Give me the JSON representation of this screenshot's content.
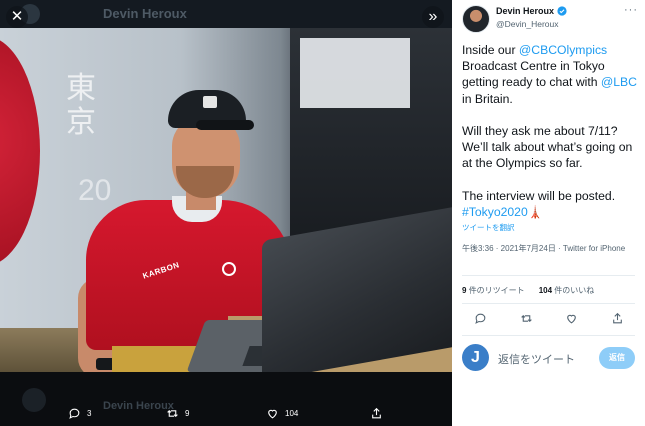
{
  "viewer": {
    "background_author": "Devin Heroux",
    "background_footer_author": "Devin Heroux",
    "background_bottom_avatar_letter": "J",
    "kanji_text": "東京",
    "year_text": "20",
    "shirt_brand": "KARBON",
    "close_icon": "close-icon",
    "collapse_icon": "chevrons-right-icon",
    "actions": {
      "reply_count": "3",
      "retweet_count": "9",
      "like_count": "104"
    }
  },
  "tweet": {
    "author_name": "Devin Heroux",
    "author_handle": "@Devin_Heroux",
    "more_label": "···",
    "text": {
      "p1_a": "Inside our ",
      "p1_link1": "@CBCOlympics",
      "p1_b": " Broadcast Centre in Tokyo getting ready to chat with ",
      "p1_link2": "@LBC",
      "p1_c": " in Britain.",
      "p2": "Will they ask me about 7/11? We’ll talk about what’s going on at the Olympics so far.",
      "p3": "The interview will be posted. ",
      "hashtag": "#Tokyo2020",
      "emoji": "🗼"
    },
    "translate_label": "ツイートを翻訳",
    "meta": "午後3:36 · 2021年7月24日 · Twitter for iPhone",
    "stats": {
      "retweets_value": "9",
      "retweets_label": "件のリツイート",
      "likes_value": "104",
      "likes_label": "件のいいね"
    },
    "reply": {
      "avatar_letter": "J",
      "placeholder": "返信をツイート",
      "button_label": "返信"
    }
  },
  "colors": {
    "link": "#1d9bf0",
    "reply_button": "#8ecdf8",
    "shirt_red": "#d6182e",
    "text_primary": "#0f1419",
    "text_secondary": "#536471"
  }
}
